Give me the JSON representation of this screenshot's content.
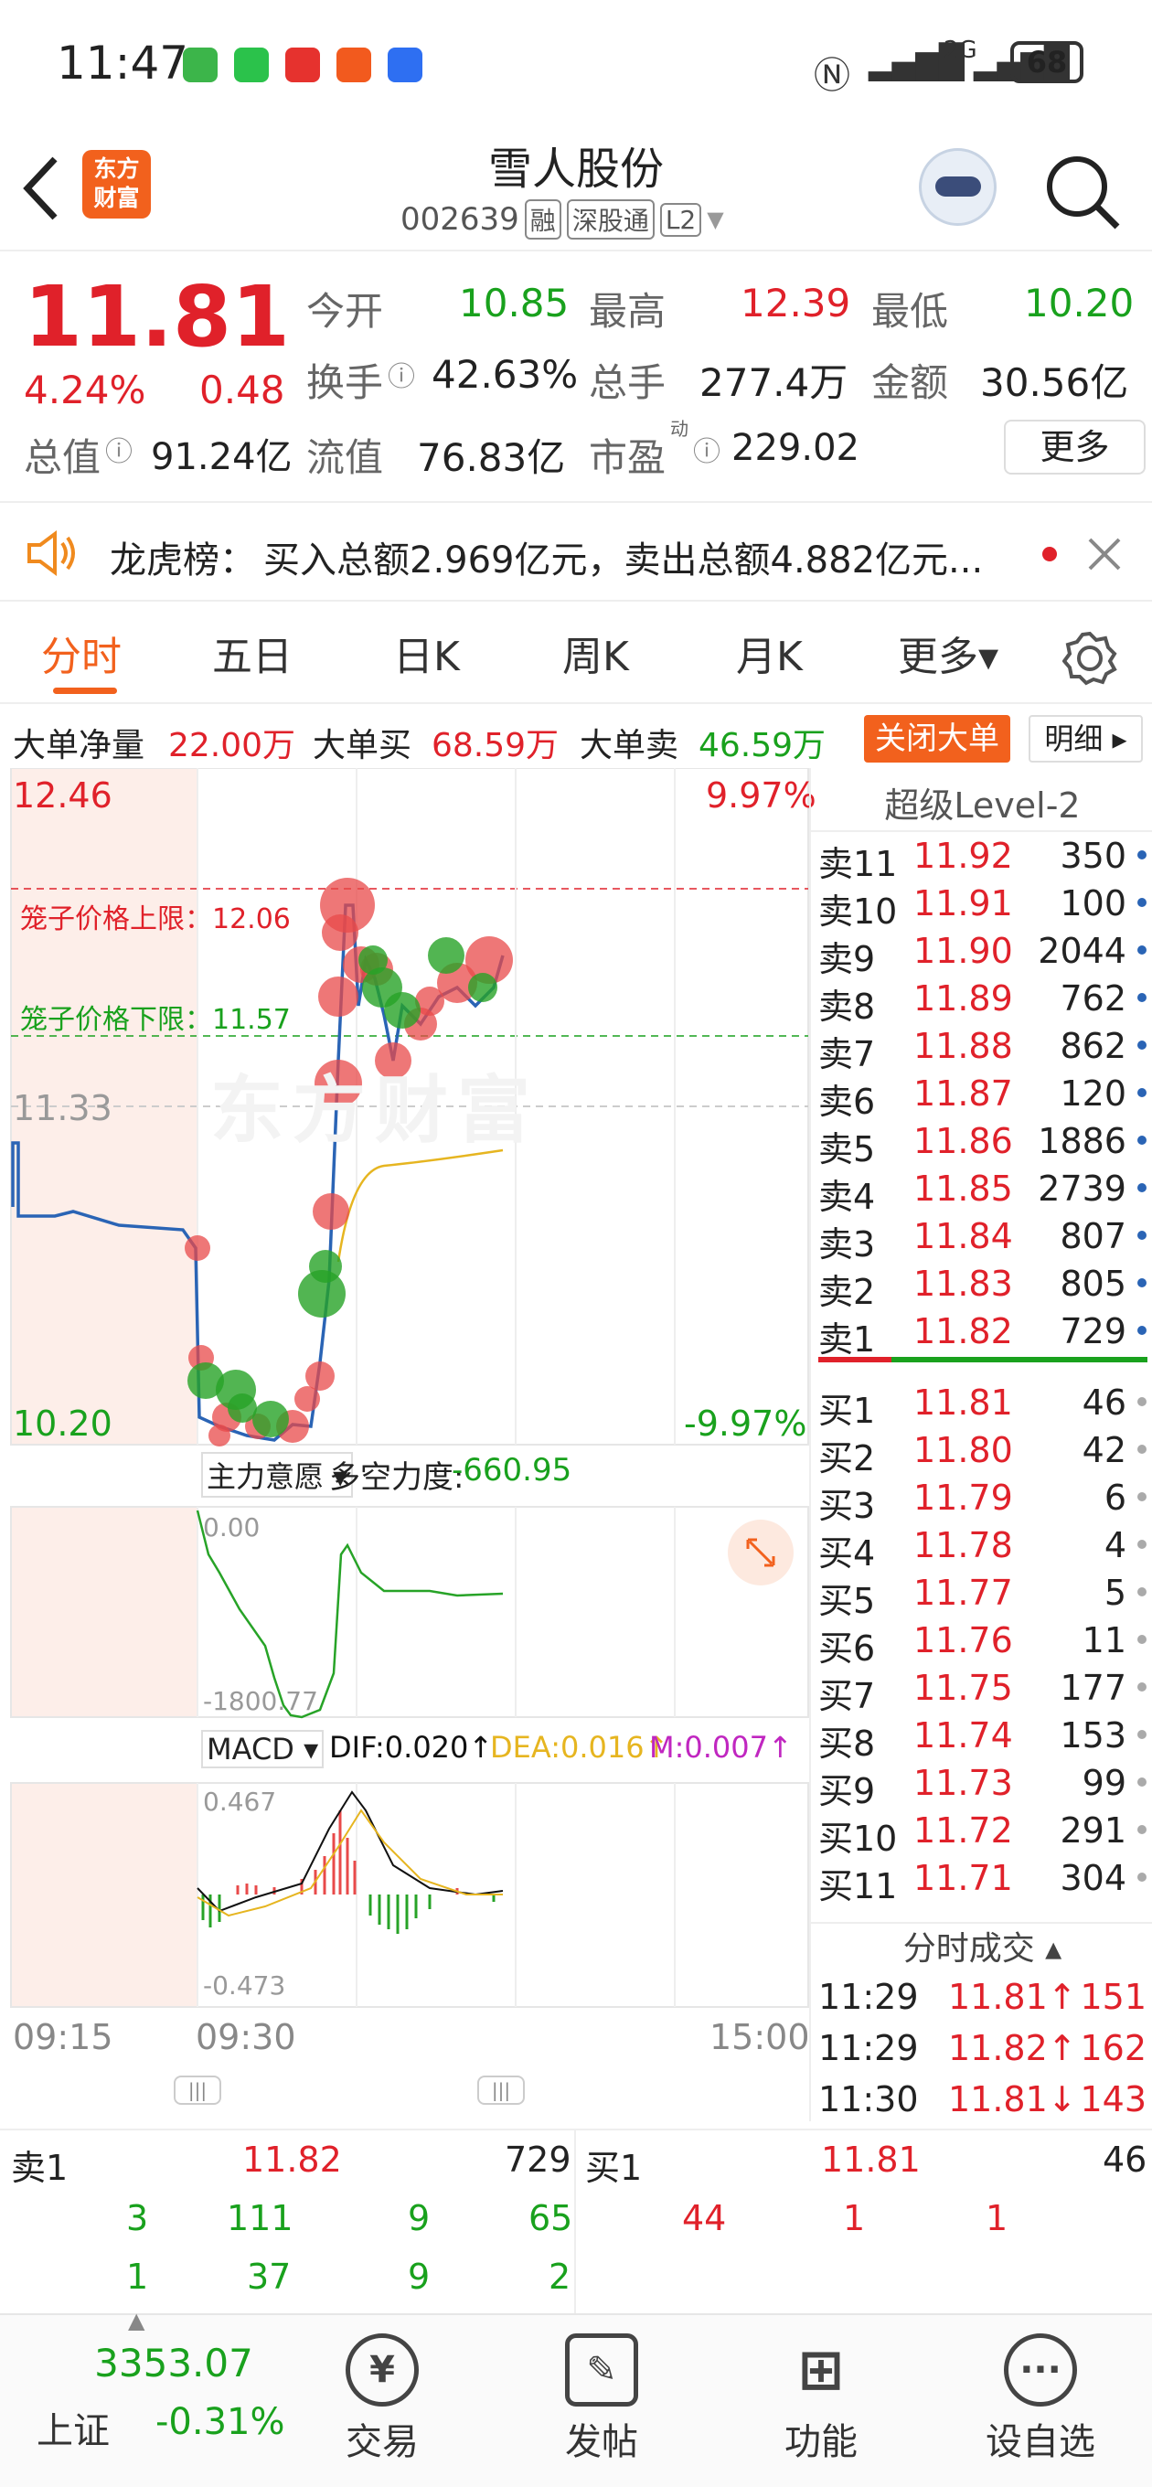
{
  "status": {
    "time": "11:47",
    "battery": "68",
    "network": "2G"
  },
  "header": {
    "title": "雪人股份",
    "code": "002639",
    "tags": [
      "融",
      "深股通",
      "L2"
    ],
    "logo_text_1": "东方",
    "logo_text_2": "财富"
  },
  "quote": {
    "price": "11.81",
    "change_pct": "4.24%",
    "change": "0.48",
    "open_label": "今开",
    "open": "10.85",
    "high_label": "最高",
    "high": "12.39",
    "low_label": "最低",
    "low": "10.20",
    "turnover_label": "换手",
    "turnover": "42.63%",
    "volume_label": "总手",
    "volume": "277.4万",
    "amount_label": "金额",
    "amount": "30.56亿",
    "mktcap_label": "总值",
    "mktcap": "91.24亿",
    "float_label": "流值",
    "float": "76.83亿",
    "pe_label": "市盈",
    "pe_sup": "动",
    "pe": "229.02",
    "more_button": "更多"
  },
  "notice": {
    "label": "龙虎榜：",
    "text": "买入总额2.969亿元，卖出总额4.882亿元..."
  },
  "tabs": [
    "分时",
    "五日",
    "日K",
    "周K",
    "月K",
    "更多▾"
  ],
  "bigorder": {
    "net_label": "大单净量",
    "net": "22.00万",
    "buy_label": "大单买",
    "buy": "68.59万",
    "sell_label": "大单卖",
    "sell": "46.59万",
    "close_button": "关闭大单",
    "detail_button": "明细 ▸"
  },
  "chart": {
    "high_price": "12.46",
    "high_pct": "9.97%",
    "low_price": "10.20",
    "low_pct": "-9.97%",
    "ref_price": "11.33",
    "cage_upper": "笼子价格上限：12.06",
    "cage_lower": "笼子价格下限：11.57",
    "watermark": "东方财富",
    "indicator_label": "主力意愿 ▾",
    "force_label": "多空力度:",
    "force_value": "-660.95",
    "ind_top": "0.00",
    "ind_bottom": "-1800.77",
    "macd_label": "MACD ▾",
    "dif": "DIF:0.020↑",
    "dea": "DEA:0.016↑",
    "m": "M:0.007↑",
    "macd_top": "0.467",
    "macd_bottom": "-0.473",
    "times": [
      "09:15",
      "09:30",
      "15:00"
    ]
  },
  "book": {
    "title": "超级Level-2",
    "asks": [
      {
        "label": "卖11",
        "price": "11.92",
        "vol": "350"
      },
      {
        "label": "卖10",
        "price": "11.91",
        "vol": "100"
      },
      {
        "label": "卖9",
        "price": "11.90",
        "vol": "2044"
      },
      {
        "label": "卖8",
        "price": "11.89",
        "vol": "762"
      },
      {
        "label": "卖7",
        "price": "11.88",
        "vol": "862"
      },
      {
        "label": "卖6",
        "price": "11.87",
        "vol": "120"
      },
      {
        "label": "卖5",
        "price": "11.86",
        "vol": "1886"
      },
      {
        "label": "卖4",
        "price": "11.85",
        "vol": "2739"
      },
      {
        "label": "卖3",
        "price": "11.84",
        "vol": "807"
      },
      {
        "label": "卖2",
        "price": "11.83",
        "vol": "805"
      },
      {
        "label": "卖1",
        "price": "11.82",
        "vol": "729"
      }
    ],
    "bids": [
      {
        "label": "买1",
        "price": "11.81",
        "vol": "46"
      },
      {
        "label": "买2",
        "price": "11.80",
        "vol": "42"
      },
      {
        "label": "买3",
        "price": "11.79",
        "vol": "6"
      },
      {
        "label": "买4",
        "price": "11.78",
        "vol": "4"
      },
      {
        "label": "买5",
        "price": "11.77",
        "vol": "5"
      },
      {
        "label": "买6",
        "price": "11.76",
        "vol": "11"
      },
      {
        "label": "买7",
        "price": "11.75",
        "vol": "177"
      },
      {
        "label": "买8",
        "price": "11.74",
        "vol": "153"
      },
      {
        "label": "买9",
        "price": "11.73",
        "vol": "99"
      },
      {
        "label": "买10",
        "price": "11.72",
        "vol": "291"
      },
      {
        "label": "买11",
        "price": "11.71",
        "vol": "304"
      }
    ],
    "ticks_title": "分时成交 ▴",
    "ticks": [
      {
        "time": "11:29",
        "price": "11.81↑",
        "vol": "151"
      },
      {
        "time": "11:29",
        "price": "11.82↑",
        "vol": "162"
      },
      {
        "time": "11:30",
        "price": "11.81↓",
        "vol": "143"
      }
    ]
  },
  "trade": {
    "sell_label": "卖1",
    "sell_price": "11.82",
    "sell_vol": "729",
    "buy_label": "买1",
    "buy_price": "11.81",
    "buy_vol": "46",
    "sell_row1": [
      "3",
      "111",
      "9",
      "65"
    ],
    "sell_row2": [
      "1",
      "37",
      "9",
      "2"
    ],
    "buy_row1": [
      "44",
      "1",
      "1"
    ]
  },
  "nav": {
    "index_value": "3353.07",
    "index_name": "上证",
    "index_change": "-0.31%",
    "items": [
      "交易",
      "发帖",
      "功能",
      "设自选"
    ]
  }
}
